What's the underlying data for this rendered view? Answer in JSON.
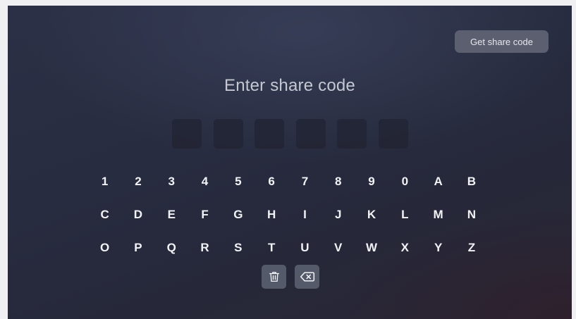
{
  "header": {
    "get_share_code_label": "Get share code"
  },
  "main": {
    "title": "Enter share code",
    "code_length": 6,
    "code_slots": [
      "",
      "",
      "",
      "",
      "",
      ""
    ]
  },
  "keyboard": {
    "rows": [
      [
        "1",
        "2",
        "3",
        "4",
        "5",
        "6",
        "7",
        "8",
        "9",
        "0",
        "A",
        "B"
      ],
      [
        "C",
        "D",
        "E",
        "F",
        "G",
        "H",
        "I",
        "J",
        "K",
        "L",
        "M",
        "N"
      ],
      [
        "O",
        "P",
        "Q",
        "R",
        "S",
        "T",
        "U",
        "V",
        "W",
        "X",
        "Y",
        "Z"
      ]
    ]
  },
  "tools": {
    "clear_icon": "trash-icon",
    "backspace_icon": "backspace-icon"
  },
  "colors": {
    "background": "#282c40",
    "button": "#5b5f70",
    "code_box": "#222534",
    "key_text": "#f2f3f6",
    "title_text": "#c5c7d1"
  }
}
